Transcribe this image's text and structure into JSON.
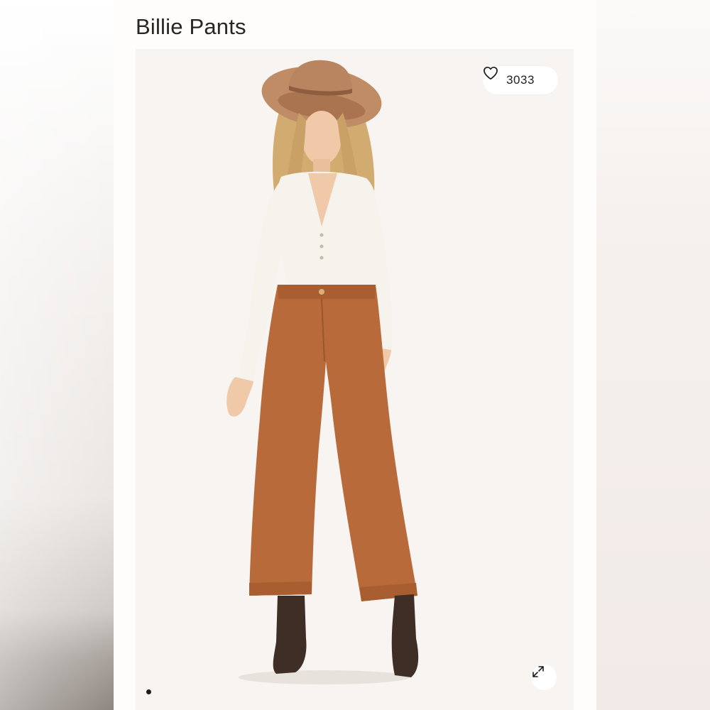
{
  "product": {
    "title": "Billie Pants"
  },
  "gallery": {
    "like_count": "3033",
    "like_icon": "heart-outline-icon",
    "expand_icon": "expand-arrows-icon",
    "pagination_count": 1,
    "active_index": 0
  },
  "colors": {
    "pants": "#b86a3a",
    "top": "#f6f2ec",
    "hat": "#c08c66",
    "boots": "#3f2e26",
    "hair": "#d2ab70",
    "background": "#f7f4f1"
  }
}
